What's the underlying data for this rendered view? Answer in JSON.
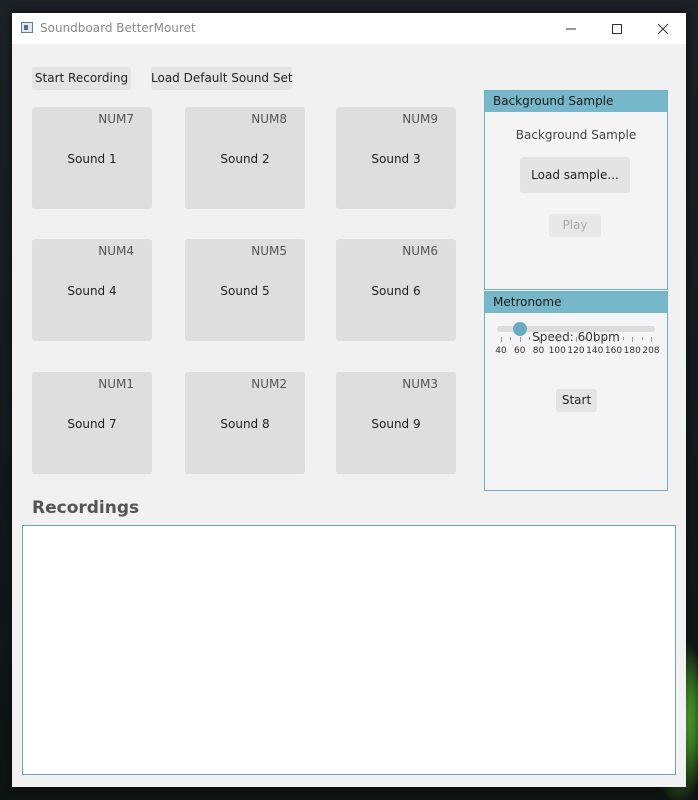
{
  "window": {
    "title": "Soundboard BetterMouret"
  },
  "toolbar": {
    "start_recording_label": "Start Recording",
    "load_default_label": "Load Default Sound Set"
  },
  "pads": [
    {
      "key": "NUM7",
      "label": "Sound 1"
    },
    {
      "key": "NUM8",
      "label": "Sound 2"
    },
    {
      "key": "NUM9",
      "label": "Sound 3"
    },
    {
      "key": "NUM4",
      "label": "Sound 4"
    },
    {
      "key": "NUM5",
      "label": "Sound 5"
    },
    {
      "key": "NUM6",
      "label": "Sound 6"
    },
    {
      "key": "NUM1",
      "label": "Sound 7"
    },
    {
      "key": "NUM2",
      "label": "Sound 8"
    },
    {
      "key": "NUM3",
      "label": "Sound 9"
    }
  ],
  "background_sample": {
    "header": "Background Sample",
    "label": "Background Sample",
    "load_label": "Load sample...",
    "play_label": "Play"
  },
  "metronome": {
    "header": "Metronome",
    "speed_label": "Speed: 60bpm",
    "bpm_value": 60,
    "slider_min": 40,
    "slider_max": 208,
    "tick_labels": [
      "40",
      "60",
      "80",
      "100",
      "120",
      "140",
      "160",
      "180",
      "208"
    ],
    "start_label": "Start"
  },
  "recordings": {
    "title": "Recordings"
  },
  "colors": {
    "accent": "#76b7c9",
    "pad": "#dedede",
    "button": "#e4e4e4"
  },
  "icons": {
    "window_app": "app-icon",
    "minimize": "minimize-icon",
    "maximize": "maximize-icon",
    "close": "close-icon"
  }
}
